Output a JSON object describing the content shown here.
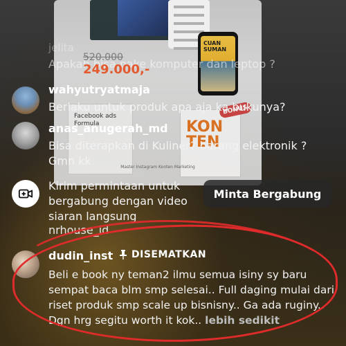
{
  "background": {
    "screen": {
      "phone_title": "CUAN SUMAN",
      "page2_text": "Facebook ads Formula",
      "konten_word": "KON TEN",
      "bonus_badge": "BONUS",
      "caption": "Master Instagram Konten Marketing"
    },
    "old_comment": {
      "username": "jelita",
      "text": "Apakah bisa pake komputer dan leptop ?"
    },
    "prices": {
      "old": "520.000",
      "new": "249.000,-"
    }
  },
  "comments": [
    {
      "username": "wahyutryatmaja",
      "text": "Berlaku untuk produk apa aja ka bukunya?"
    },
    {
      "username": "anas_anugerah_md",
      "text": "Bisa diterapkan di Kuliner? barang elektronik ? Gmn kk"
    }
  ],
  "request": {
    "text": "Kirim permintaan untuk bergabung dengan video siaran langsung",
    "below_text": "nrhouse_id",
    "button_label": "Minta Bergabung"
  },
  "pinned": {
    "username": "dudin_inst",
    "pin_label": "DISEMATKAN",
    "text": "Beli e book ny teman2 ilmu semua isiny sy baru sempat baca blm smp selesai.. Full daging mulai dari riset produk smp scale up bisnisny.. Ga ada ruginy.. Dgn hrg segitu worth it kok..",
    "more_label": "lebih sedikit"
  },
  "colors": {
    "annotation_red": "#e02b2b",
    "price_new": "#e35a2e"
  }
}
